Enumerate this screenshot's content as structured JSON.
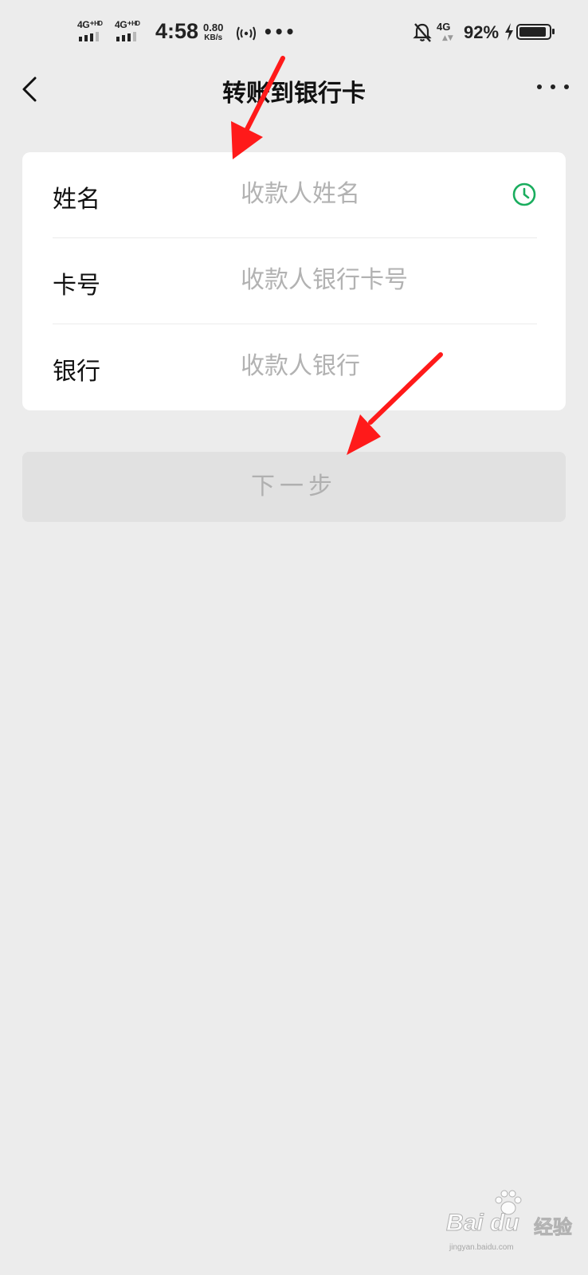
{
  "status_bar": {
    "sim1_label": "4G⁺ᴴᴰ",
    "sim2_label": "4G⁺ᴴᴰ",
    "time": "4:58",
    "speed_value": "0.80",
    "speed_unit": "KB/s",
    "more_dots": "•••",
    "network_label": "4G",
    "network_arrows": "▲▼",
    "battery_percent": "92%",
    "battery_level": 0.92
  },
  "navbar": {
    "title": "转账到银行卡"
  },
  "form": {
    "rows": [
      {
        "label": "姓名",
        "placeholder": "收款人姓名",
        "value": ""
      },
      {
        "label": "卡号",
        "placeholder": "收款人银行卡号",
        "value": ""
      },
      {
        "label": "银行",
        "placeholder": "收款人银行",
        "value": ""
      }
    ]
  },
  "next_button": {
    "label": "下一步"
  },
  "colors": {
    "background": "#ececec",
    "card": "#ffffff",
    "accent_green": "#1aad5e",
    "placeholder": "#b2b2b2",
    "button_disabled_bg": "#e1e1e1",
    "button_disabled_text": "#b0b0b0",
    "annotation_red": "#ff1a1a"
  },
  "watermark": {
    "logo": "Bai du",
    "text": "经验",
    "url": "jingyan.baidu.com"
  }
}
